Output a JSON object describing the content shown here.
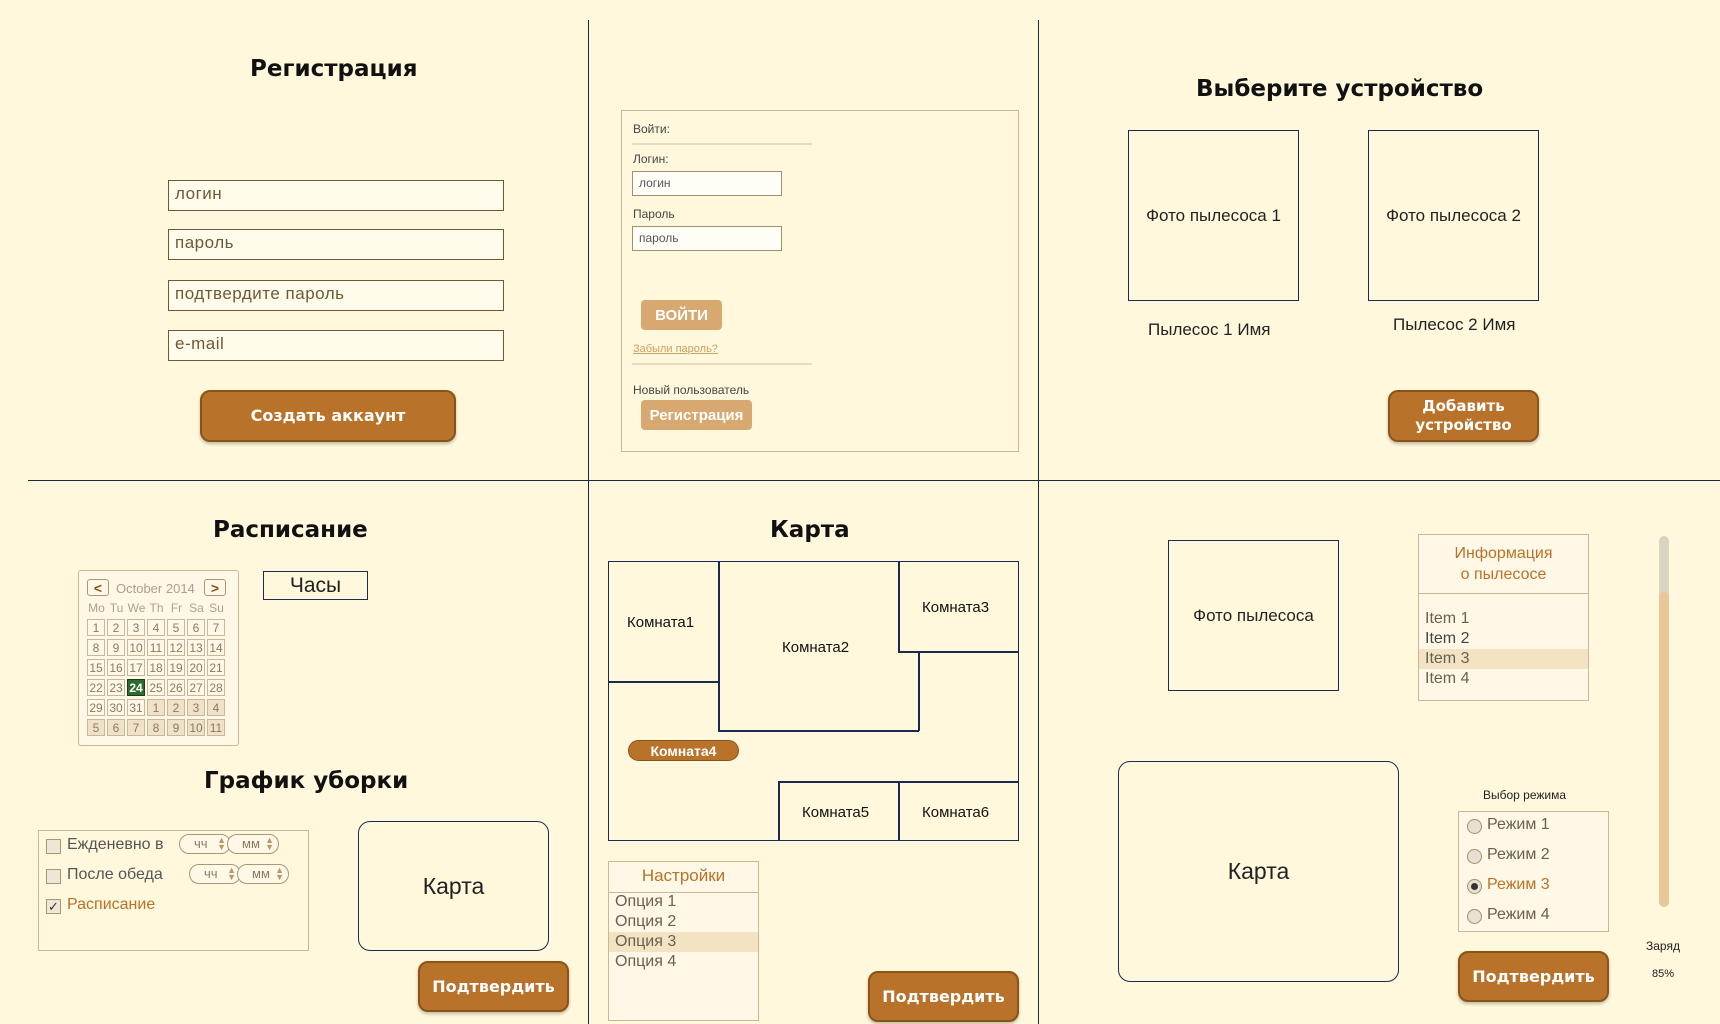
{
  "registration": {
    "title": "Регистрация",
    "login_placeholder": "логин",
    "password_placeholder": "пароль",
    "confirm_placeholder": "подтвердите пароль",
    "email_placeholder": "e-mail",
    "create_button": "Создать аккаунт"
  },
  "login": {
    "heading": "Войти:",
    "login_label": "Логин:",
    "login_value": "логин",
    "password_label": "Пароль",
    "password_value": "пароль",
    "enter_button": "ВОЙТИ",
    "forgot_link": "Забыли пароль?",
    "new_user_label": "Новый пользователь",
    "register_button": "Регистрация"
  },
  "devices": {
    "title": "Выберите устройство",
    "items": [
      {
        "photo": "Фото пылесоса 1",
        "name": "Пылесос 1 Имя"
      },
      {
        "photo": "Фото пылесоса 2",
        "name": "Пылесос 2 Имя"
      }
    ],
    "add_button": "Добавить устройство"
  },
  "schedule": {
    "title": "Расписание",
    "clock_label": "Часы",
    "calendar": {
      "month_label": "October 2014",
      "prev": "<",
      "next": ">",
      "weekdays": [
        "Mo",
        "Tu",
        "We",
        "Th",
        "Fr",
        "Sa",
        "Su"
      ],
      "rows": [
        [
          "1",
          "2",
          "3",
          "4",
          "5",
          "6",
          "7"
        ],
        [
          "8",
          "9",
          "10",
          "11",
          "12",
          "13",
          "14"
        ],
        [
          "15",
          "16",
          "17",
          "18",
          "19",
          "20",
          "21"
        ],
        [
          "22",
          "23",
          "24",
          "25",
          "26",
          "27",
          "28"
        ],
        [
          "29",
          "30",
          "31",
          "1",
          "2",
          "3",
          "4"
        ],
        [
          "5",
          "6",
          "7",
          "8",
          "9",
          "10",
          "11"
        ]
      ],
      "selected": "24",
      "accent": "#2e6b2e"
    },
    "cleaning_title": "График уборки",
    "options": [
      {
        "label": "Ежденевно в",
        "checked": false,
        "hh": "чч",
        "mm": "мм"
      },
      {
        "label": "После обеда",
        "checked": false,
        "hh": "чч",
        "mm": "мм"
      },
      {
        "label": "Расписание",
        "checked": true
      }
    ],
    "map_label": "Карта",
    "confirm_button": "Подтвердить"
  },
  "map": {
    "title": "Карта",
    "rooms": [
      "Комната1",
      "Комната2",
      "Комната3",
      "Комната4",
      "Комната5",
      "Комната6"
    ],
    "settings": {
      "title": "Настройки",
      "options": [
        "Опция 1",
        "Опция 2",
        "Опция 3",
        "Опция 4"
      ],
      "selected_index": 2
    },
    "confirm_button": "Подтвердить"
  },
  "device_detail": {
    "photo": "Фото пылесоса",
    "info_title_line1": "Информация",
    "info_title_line2": "о пылесосе",
    "items": [
      "Item 1",
      "Item 2",
      "Item 3",
      "Item 4"
    ],
    "selected_index": 2,
    "map_label": "Карта",
    "mode_title": "Выбор режима",
    "modes": [
      "Режим 1",
      "Режим 2",
      "Режим 3",
      "Режим 4"
    ],
    "selected_mode": 2,
    "charge_label": "Заряд",
    "charge_value": "85%",
    "charge_fraction": 0.85,
    "confirm_button": "Подтвердить"
  },
  "colors": {
    "background": "#fff8dc",
    "button": "#b8722a",
    "button_light": "#d7a870",
    "accent_text": "#b8722a"
  }
}
